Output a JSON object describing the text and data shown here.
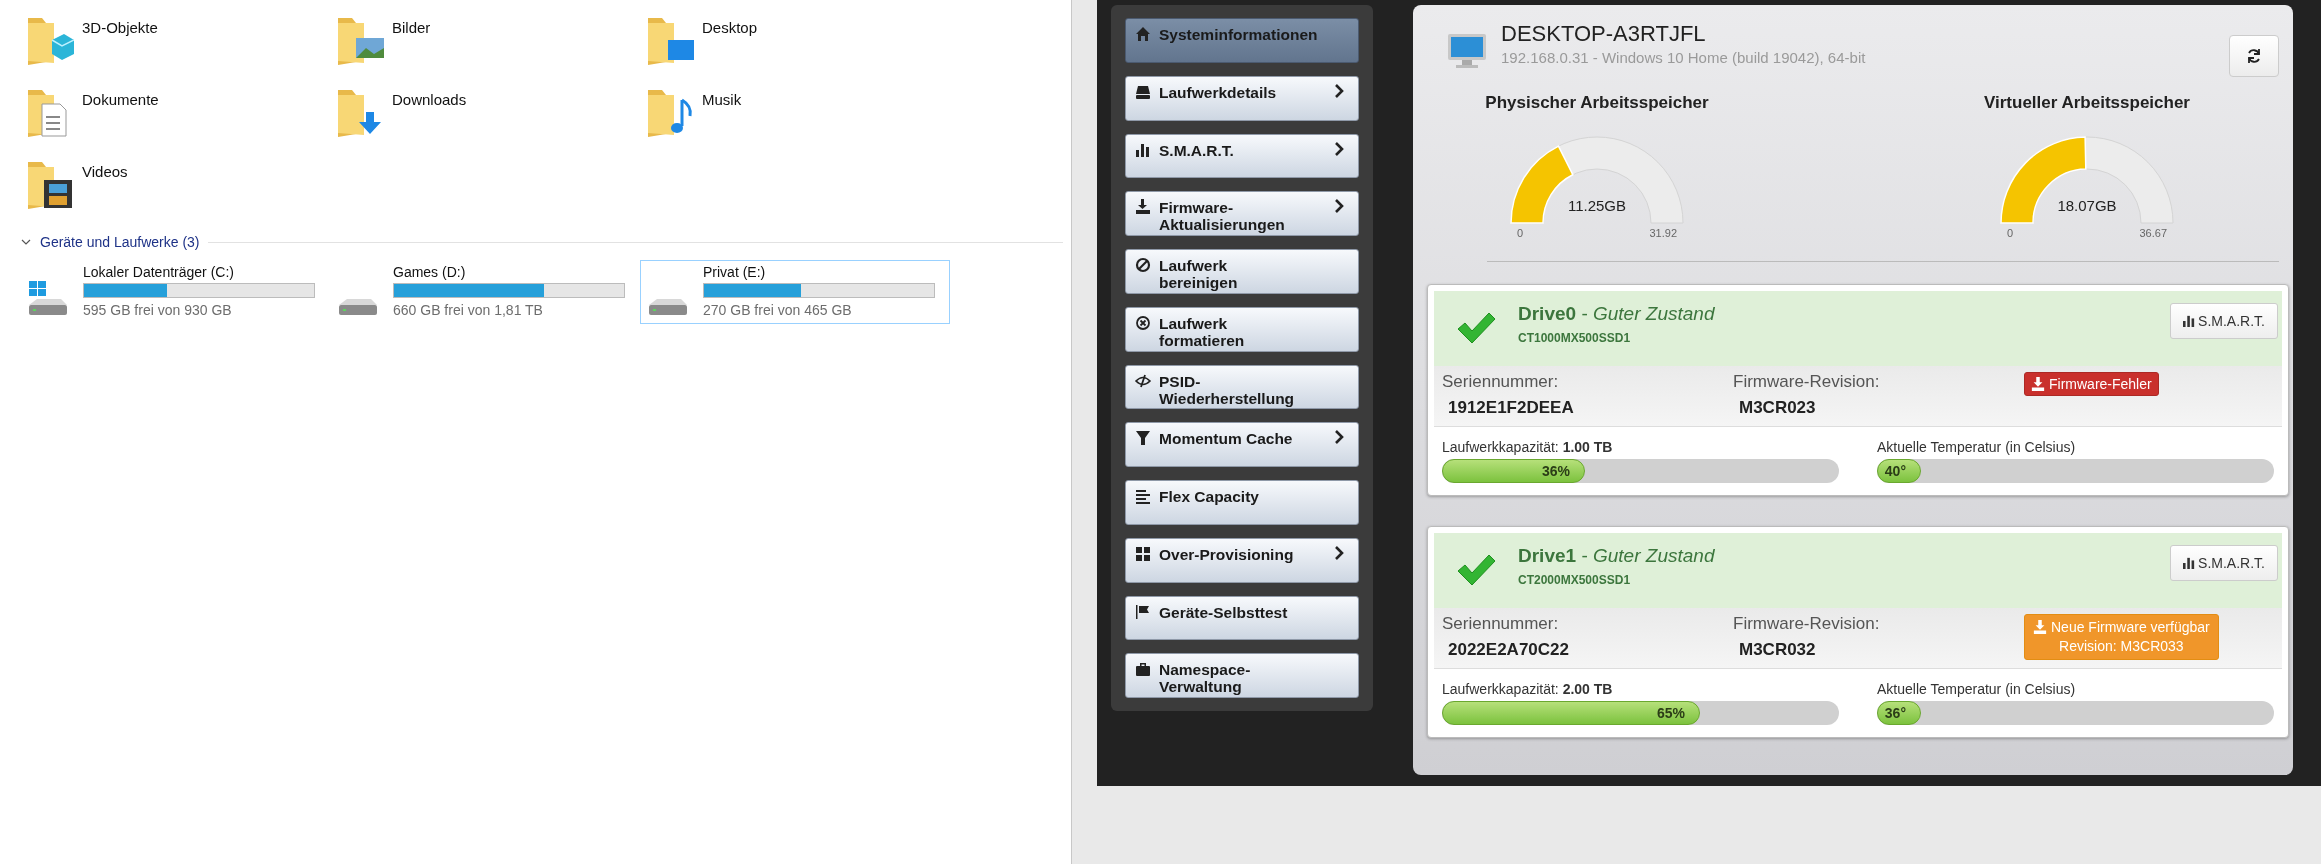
{
  "explorer": {
    "folders": [
      {
        "name": "3D-Objekte",
        "kind": "objects3d"
      },
      {
        "name": "Bilder",
        "kind": "pictures"
      },
      {
        "name": "Desktop",
        "kind": "desktop"
      },
      {
        "name": "Dokumente",
        "kind": "documents"
      },
      {
        "name": "Downloads",
        "kind": "downloads"
      },
      {
        "name": "Musik",
        "kind": "music"
      },
      {
        "name": "Videos",
        "kind": "videos"
      }
    ],
    "devices_section": {
      "title": "Geräte und Laufwerke (3)",
      "expanded": true
    },
    "drives": [
      {
        "name": "Lokaler Datenträger (C:)",
        "kind": "system",
        "level": 0.36,
        "free": "595 GB frei von 930 GB",
        "selected": false
      },
      {
        "name": "Games (D:)",
        "kind": "plain",
        "level": 0.65,
        "free": "660 GB frei von 1,81 TB",
        "selected": false
      },
      {
        "name": "Privat (E:)",
        "kind": "plain",
        "level": 0.42,
        "free": "270 GB frei von 465 GB",
        "selected": true
      }
    ]
  },
  "sidebar": {
    "items": [
      {
        "label": "Systeminformationen",
        "kind": "home",
        "selected": true,
        "submenu": false
      },
      {
        "label": "Laufwerkdetails",
        "kind": "drive",
        "selected": false,
        "submenu": true
      },
      {
        "label": "S.M.A.R.T.",
        "kind": "bars",
        "selected": false,
        "submenu": true
      },
      {
        "label": "Firmware-\nAktualisierungen",
        "kind": "download",
        "selected": false,
        "submenu": true
      },
      {
        "label": "Laufwerk\nbereinigen",
        "kind": "ban",
        "selected": false,
        "submenu": false
      },
      {
        "label": "Laufwerk\nformatieren",
        "kind": "xcircle",
        "selected": false,
        "submenu": false
      },
      {
        "label": "PSID-\nWiederherstellung",
        "kind": "eyeslash",
        "selected": false,
        "submenu": false
      },
      {
        "label": "Momentum Cache",
        "kind": "filter",
        "selected": false,
        "submenu": true
      },
      {
        "label": "Flex Capacity",
        "kind": "lines",
        "selected": false,
        "submenu": false
      },
      {
        "label": "Over-Provisioning",
        "kind": "grid",
        "selected": false,
        "submenu": true
      },
      {
        "label": "Geräte-Selbsttest",
        "kind": "flag",
        "selected": false,
        "submenu": false
      },
      {
        "label": "Namespace-\nVerwaltung",
        "kind": "briefcase",
        "selected": false,
        "submenu": false
      }
    ]
  },
  "system": {
    "hostname": "DESKTOP-A3RTJFL",
    "details": "192.168.0.31 - Windows 10 Home (build 19042), 64-bit",
    "gauges": [
      {
        "title": "Physischer Arbeitsspeicher",
        "level": 0.352,
        "value": "11.25GB",
        "min": "0",
        "max": "31.92"
      },
      {
        "title": "Virtueller Arbeitsspeicher",
        "level": 0.493,
        "value": "18.07GB",
        "min": "0",
        "max": "36.67"
      }
    ]
  },
  "drives": [
    {
      "title": "**Drive0** - *Guter Zustand*",
      "model": "CT1000MX500SSD1",
      "smart_button": "S.M.A.R.T.",
      "serial_label": "Seriennummer:",
      "serial": "1912E1F2DEEA",
      "firmware_label": "Firmware-Revision:",
      "firmware": "M3CR023",
      "firmware_button": {
        "kind": "error",
        "label": "Firmware-Fehler"
      },
      "capacity": {
        "label": "Laufwerkkapazität: **1.00 TB**",
        "level": 0.36,
        "reading": "36%"
      },
      "temperature": {
        "label": "Aktuelle Temperatur (in Celsius)",
        "level": 0.11,
        "reading": "40°"
      }
    },
    {
      "title": "**Drive1** - *Guter Zustand*",
      "model": "CT2000MX500SSD1",
      "smart_button": "S.M.A.R.T.",
      "serial_label": "Seriennummer:",
      "serial": "2022E2A70C22",
      "firmware_label": "Firmware-Revision:",
      "firmware": "M3CR032",
      "firmware_button": {
        "kind": "update",
        "label": "Neue Firmware verfügbar",
        "revision": "Revision: M3CR033"
      },
      "capacity": {
        "label": "Laufwerkkapazität: **2.00 TB**",
        "level": 0.65,
        "reading": "65%"
      },
      "temperature": {
        "label": "Aktuelle Temperatur (in Celsius)",
        "level": 0.11,
        "reading": "36°"
      }
    }
  ]
}
